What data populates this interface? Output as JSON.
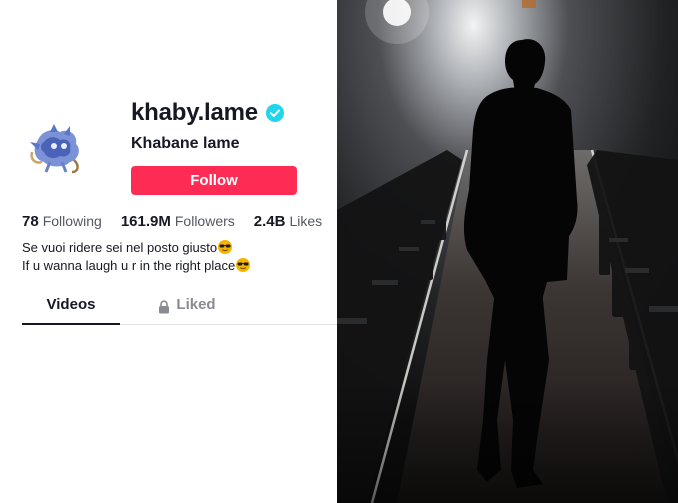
{
  "profile": {
    "username": "khaby.lame",
    "nickname": "Khabane lame",
    "follow_label": "Follow",
    "verified_icon": "verified-badge-icon",
    "avatar_icon": "anime-character-avatar",
    "stats": [
      {
        "value": "78",
        "label": "Following"
      },
      {
        "value": "161.9M",
        "label": "Followers"
      },
      {
        "value": "2.4B",
        "label": "Likes"
      }
    ],
    "bio": [
      {
        "text": "Se vuoi ridere sei nel posto giusto",
        "emoji": "smiling-face-with-sunglasses"
      },
      {
        "text": "If u wanna laugh u r in the right place",
        "emoji": "smiling-face-with-sunglasses"
      }
    ],
    "tabs": {
      "videos": "Videos",
      "liked": "Liked",
      "liked_icon": "lock-icon",
      "active": "videos"
    }
  },
  "colors": {
    "follow_button": "#fe2c55",
    "verified": "#20d5ec",
    "text": "#161823",
    "muted": "#8a8b91"
  },
  "photo": {
    "description_icon": "man-silhouette-in-theater-aisle-photo"
  }
}
